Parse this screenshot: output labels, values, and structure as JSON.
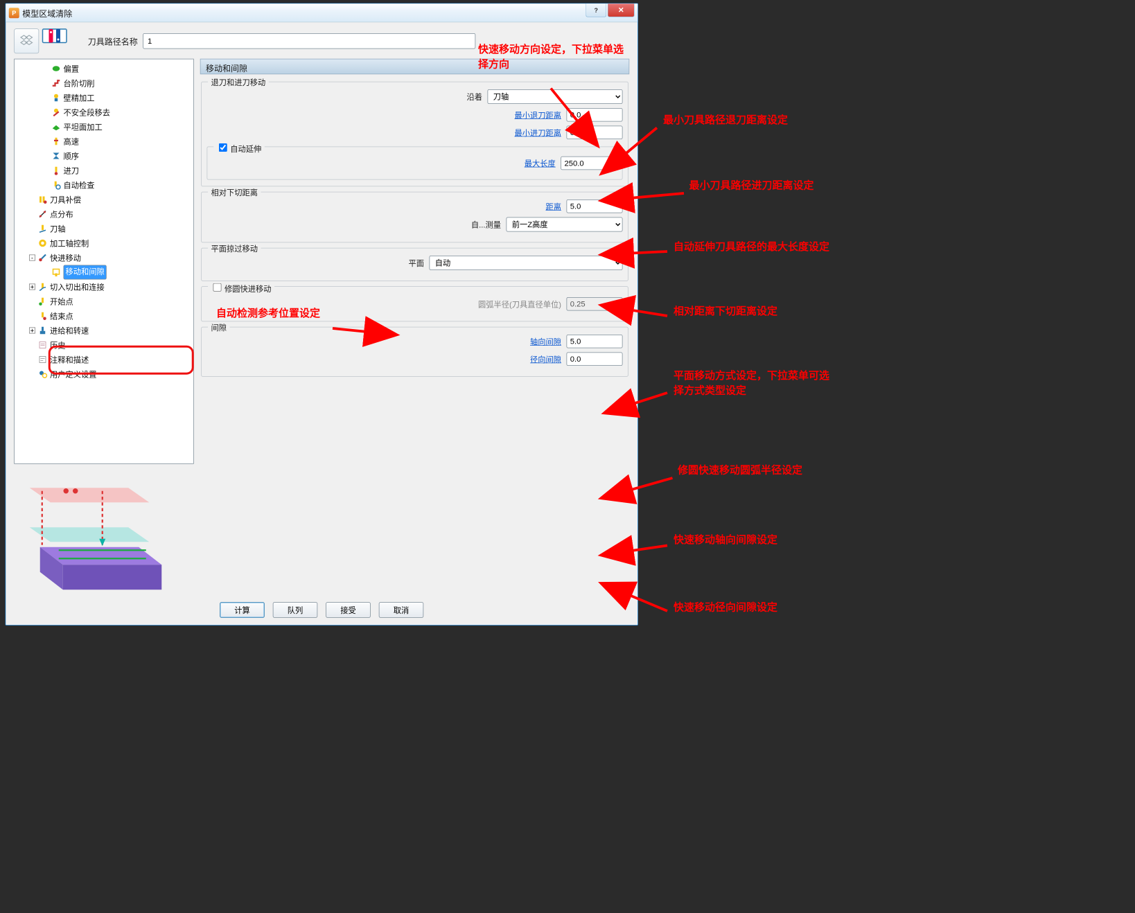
{
  "win": {
    "title": "模型区域清除"
  },
  "toolpath": {
    "name_label": "刀具路径名称",
    "name_value": "1"
  },
  "tree": [
    {
      "ind": 2,
      "icon": "green-dot",
      "label": "偏置"
    },
    {
      "ind": 2,
      "icon": "red-step",
      "label": "台阶切削"
    },
    {
      "ind": 2,
      "icon": "yl-wall",
      "label": "壁精加工"
    },
    {
      "ind": 2,
      "icon": "unsafe",
      "label": "不安全段移去"
    },
    {
      "ind": 2,
      "icon": "flat",
      "label": "平坦面加工"
    },
    {
      "ind": 2,
      "icon": "speed",
      "label": "高速"
    },
    {
      "ind": 2,
      "icon": "order",
      "label": "顺序"
    },
    {
      "ind": 2,
      "icon": "lead",
      "label": "进刀"
    },
    {
      "ind": 2,
      "icon": "check",
      "label": "自动检查"
    },
    {
      "ind": 1,
      "icon": "comp",
      "label": "刀具补偿"
    },
    {
      "ind": 1,
      "icon": "pts",
      "label": "点分布"
    },
    {
      "ind": 1,
      "icon": "axis",
      "label": "刀轴"
    },
    {
      "ind": 1,
      "icon": "mach",
      "label": "加工轴控制"
    },
    {
      "ind": 1,
      "exp": "-",
      "icon": "rapid",
      "label": "快进移动"
    },
    {
      "ind": 2,
      "icon": "moves",
      "label": "移动和间隙",
      "sel": true
    },
    {
      "ind": 1,
      "exp": "+",
      "icon": "cut",
      "label": "切入切出和连接"
    },
    {
      "ind": 1,
      "icon": "start",
      "label": "开始点"
    },
    {
      "ind": 1,
      "icon": "end",
      "label": "结束点"
    },
    {
      "ind": 1,
      "exp": "+",
      "icon": "feed",
      "label": "进给和转速"
    },
    {
      "ind": 1,
      "icon": "hist",
      "label": "历史"
    },
    {
      "ind": 1,
      "icon": "note",
      "label": "注释和描述"
    },
    {
      "ind": 1,
      "icon": "user",
      "label": "用户定义设置"
    }
  ],
  "panel": {
    "header": "移动和间隙",
    "retract_group": "退刀和进刀移动",
    "along_label": "沿着",
    "along_value": "刀轴",
    "min_retract_label": "最小退刀距离",
    "min_retract_value": "0.0",
    "min_approach_label": "最小进刀距离",
    "min_approach_value": "0.0",
    "auto_ext_label": "自动延伸",
    "max_len_label": "最大长度",
    "max_len_value": "250.0",
    "rel_group": "相对下切距离",
    "dist_label": "距离",
    "dist_value": "5.0",
    "auto_meas_label": "自...测量",
    "auto_meas_value": "前一Z高度",
    "plane_group": "平面掠过移动",
    "plane_label": "平面",
    "plane_value": "自动",
    "arc_group": "修圆快进移动",
    "arc_label": "圆弧半径(刀具直径单位)",
    "arc_value": "0.25",
    "gap_group": "间隙",
    "ax_gap_label": "轴向间隙",
    "ax_gap_value": "5.0",
    "rad_gap_label": "径向间隙",
    "rad_gap_value": "0.0"
  },
  "buttons": {
    "calc": "计算",
    "queue": "队列",
    "accept": "接受",
    "cancel": "取消"
  },
  "annotations": {
    "a1": "快速移动方向设定，下拉菜单选择方向",
    "a2": "最小刀具路径退刀距离设定",
    "a3": "最小刀具路径进刀距离设定",
    "a4": "自动延伸刀具路径的最大长度设定",
    "a5": "相对距离下切距离设定",
    "a6": "平面移动方式设定，下拉菜单可选择方式类型设定",
    "a7": "修圆快速移动圆弧半径设定",
    "a8": "快速移动轴向间隙设定",
    "a9": "快速移动径向间隙设定",
    "a10": "自动检测参考位置设定"
  }
}
